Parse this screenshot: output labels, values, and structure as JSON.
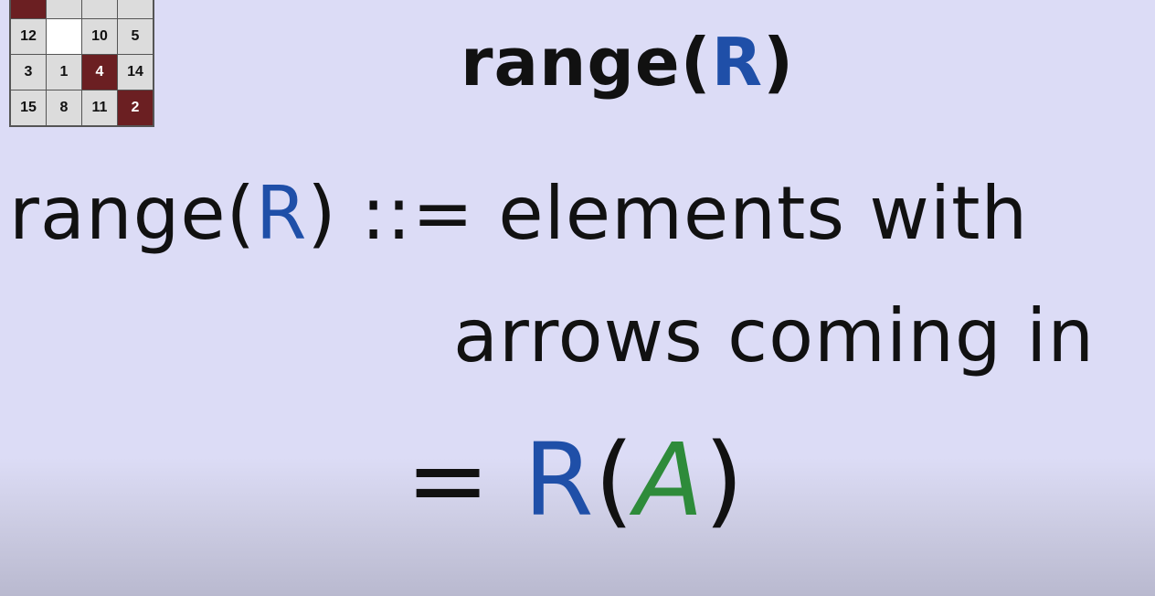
{
  "puzzle": {
    "tiles": [
      {
        "label": "",
        "style": "dark"
      },
      {
        "label": "",
        "style": "light"
      },
      {
        "label": "",
        "style": "light"
      },
      {
        "label": "",
        "style": "light"
      },
      {
        "label": "12",
        "style": "light"
      },
      {
        "label": "",
        "style": "blank"
      },
      {
        "label": "10",
        "style": "light"
      },
      {
        "label": "5",
        "style": "light"
      },
      {
        "label": "3",
        "style": "light"
      },
      {
        "label": "1",
        "style": "light"
      },
      {
        "label": "4",
        "style": "dark"
      },
      {
        "label": "14",
        "style": "light"
      },
      {
        "label": "15",
        "style": "light"
      },
      {
        "label": "8",
        "style": "light"
      },
      {
        "label": "11",
        "style": "light"
      },
      {
        "label": "2",
        "style": "dark"
      }
    ]
  },
  "title": {
    "prefix": "range(",
    "var": "R",
    "suffix": ")"
  },
  "definition": {
    "prefix": "range(",
    "var": "R",
    "suffix": ") ::= elements with",
    "line2": "arrows coming in"
  },
  "equation": {
    "eq": "= ",
    "func": "R",
    "open": "(",
    "arg": "A",
    "close": ")"
  },
  "colors": {
    "relation": "#1f4fa8",
    "set": "#2e8b3a",
    "tile_dark": "#6b1f22",
    "background": "#dcdcf6"
  }
}
